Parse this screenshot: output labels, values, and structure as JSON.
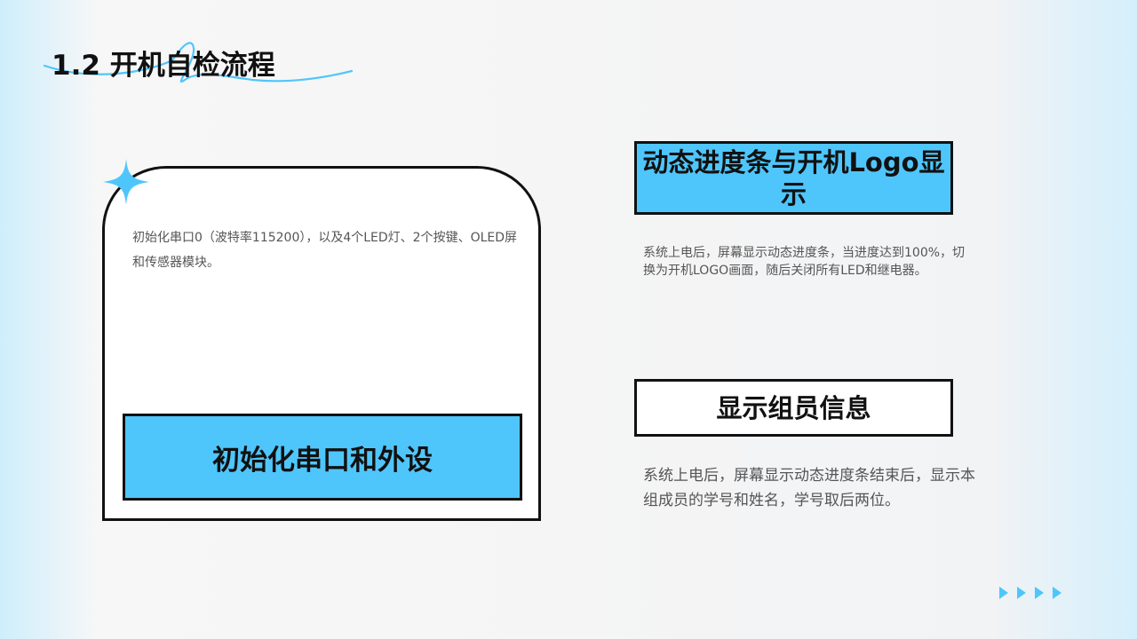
{
  "slide": {
    "title": "1.2 开机自检流程",
    "accent_color": "#4fc6fb",
    "squiggle_color": "#4fc6fb"
  },
  "left_card": {
    "description": "初始化串口0（波特率115200），以及4个LED灯、2个按键、OLED屏和传感器模块。",
    "label": "初始化串口和外设",
    "decoration_icon": "sparkle-icon"
  },
  "step_progress": {
    "label": "动态进度条与开机Logo显示",
    "description": "系统上电后，屏幕显示动态进度条，当进度达到100%，切换为开机LOGO画面，随后关闭所有LED和继电器。"
  },
  "step_members": {
    "label": "显示组员信息",
    "description": "系统上电后，屏幕显示动态进度条结束后，显示本组成员的学号和姓名，学号取后两位。"
  },
  "footer": {
    "arrow_icon": "play-arrow-icon",
    "arrow_count": 4
  }
}
